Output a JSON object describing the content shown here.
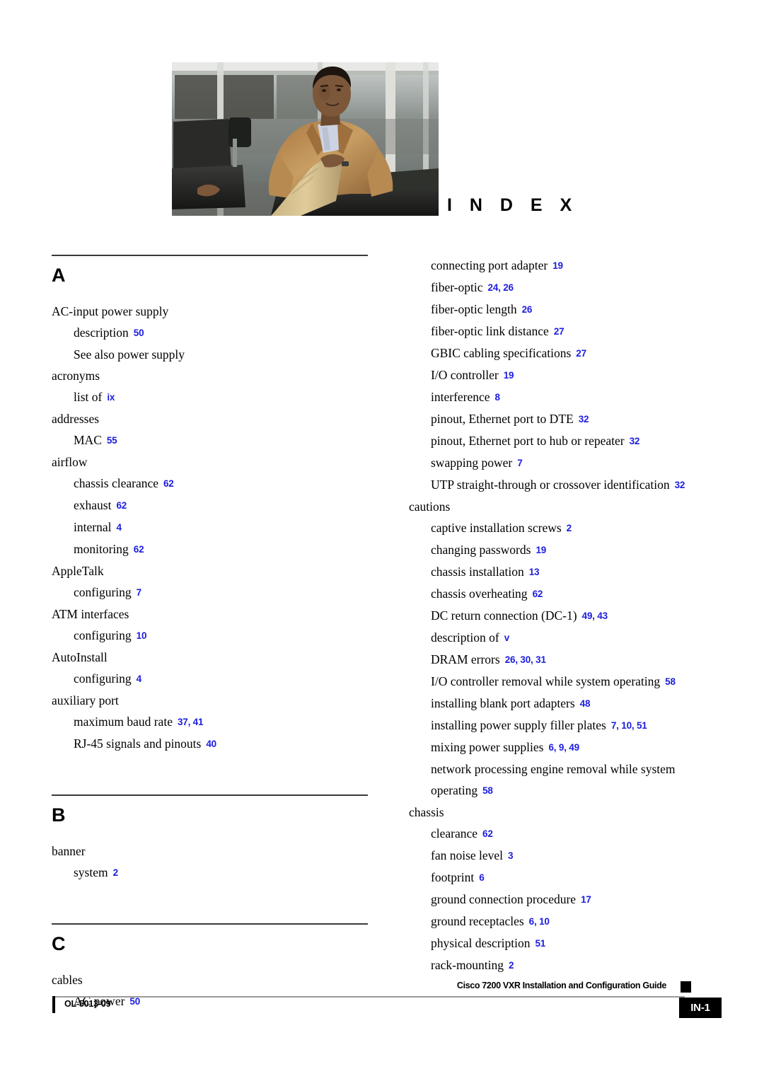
{
  "page": {
    "index_title": "I N D E X",
    "accent_page_number_color": "#1c1ce0",
    "rule_color": "#3a3a3a"
  },
  "photo": {
    "name": "cover-photo-seated-man",
    "description": "Seated man in tan jacket and khaki trousers on a dark leather sofa in front of large industrial windows"
  },
  "columns": {
    "left": {
      "sections": [
        {
          "letter": "A",
          "entries": [
            {
              "level": 0,
              "text": "AC-input power supply",
              "pages": ""
            },
            {
              "level": 1,
              "text": "description",
              "pages": "50"
            },
            {
              "level": 1,
              "text": "See also power supply",
              "pages": ""
            },
            {
              "level": 0,
              "text": "acronyms",
              "pages": ""
            },
            {
              "level": 1,
              "text": "list of",
              "pages": "ix"
            },
            {
              "level": 0,
              "text": "addresses",
              "pages": ""
            },
            {
              "level": 1,
              "text": "MAC",
              "pages": "55"
            },
            {
              "level": 0,
              "text": "airflow",
              "pages": ""
            },
            {
              "level": 1,
              "text": "chassis clearance",
              "pages": "62"
            },
            {
              "level": 1,
              "text": "exhaust",
              "pages": "62"
            },
            {
              "level": 1,
              "text": "internal",
              "pages": "4"
            },
            {
              "level": 1,
              "text": "monitoring",
              "pages": "62"
            },
            {
              "level": 0,
              "text": "AppleTalk",
              "pages": ""
            },
            {
              "level": 1,
              "text": "configuring",
              "pages": "7"
            },
            {
              "level": 0,
              "text": "ATM interfaces",
              "pages": ""
            },
            {
              "level": 1,
              "text": "configuring",
              "pages": "10"
            },
            {
              "level": 0,
              "text": "AutoInstall",
              "pages": ""
            },
            {
              "level": 1,
              "text": "configuring",
              "pages": "4"
            },
            {
              "level": 0,
              "text": "auxiliary port",
              "pages": ""
            },
            {
              "level": 1,
              "text": "maximum baud rate",
              "pages": "37, 41"
            },
            {
              "level": 1,
              "text": "RJ-45 signals and pinouts",
              "pages": "40"
            }
          ]
        },
        {
          "letter": "B",
          "entries": [
            {
              "level": 0,
              "text": "banner",
              "pages": ""
            },
            {
              "level": 1,
              "text": "system",
              "pages": "2"
            }
          ]
        },
        {
          "letter": "C",
          "entries": [
            {
              "level": 0,
              "text": "cables",
              "pages": ""
            },
            {
              "level": 1,
              "text": "AC power",
              "pages": "50"
            }
          ]
        }
      ]
    },
    "right": {
      "sections": [
        {
          "letter": "",
          "entries": [
            {
              "level": 1,
              "text": "connecting port adapter",
              "pages": "19"
            },
            {
              "level": 1,
              "text": "fiber-optic",
              "pages": "24, 26"
            },
            {
              "level": 1,
              "text": "fiber-optic length",
              "pages": "26"
            },
            {
              "level": 1,
              "text": "fiber-optic link distance",
              "pages": "27"
            },
            {
              "level": 1,
              "text": "GBIC cabling specifications",
              "pages": "27"
            },
            {
              "level": 1,
              "text": "I/O controller",
              "pages": "19"
            },
            {
              "level": 1,
              "text": "interference",
              "pages": "8"
            },
            {
              "level": 1,
              "text": "pinout, Ethernet port to DTE",
              "pages": "32"
            },
            {
              "level": 1,
              "text": "pinout, Ethernet port to hub or repeater",
              "pages": "32"
            },
            {
              "level": 1,
              "text": "swapping power",
              "pages": "7"
            },
            {
              "level": 1,
              "text": "UTP straight-through or crossover identification",
              "pages": "32"
            },
            {
              "level": 0,
              "text": "cautions",
              "pages": ""
            },
            {
              "level": 1,
              "text": "captive installation screws",
              "pages": "2"
            },
            {
              "level": 1,
              "text": "changing passwords",
              "pages": "19"
            },
            {
              "level": 1,
              "text": "chassis installation",
              "pages": "13"
            },
            {
              "level": 1,
              "text": "chassis overheating",
              "pages": "62"
            },
            {
              "level": 1,
              "text": "DC return connection (DC-1)",
              "pages": "49, 43"
            },
            {
              "level": 1,
              "text": "description of",
              "pages": "v"
            },
            {
              "level": 1,
              "text": "DRAM errors",
              "pages": "26, 30, 31"
            },
            {
              "level": 1,
              "text": "I/O controller removal while system operating",
              "pages": "58"
            },
            {
              "level": 1,
              "text": "installing blank port adapters",
              "pages": "48"
            },
            {
              "level": 1,
              "text": "installing power supply filler plates",
              "pages": "7, 10, 51"
            },
            {
              "level": 1,
              "text": "mixing power supplies",
              "pages": "6, 9, 49"
            },
            {
              "level": 1,
              "text": "network processing engine removal while system operating",
              "pages": "58"
            },
            {
              "level": 0,
              "text": "chassis",
              "pages": ""
            },
            {
              "level": 1,
              "text": "clearance",
              "pages": "62"
            },
            {
              "level": 1,
              "text": "fan noise level",
              "pages": "3"
            },
            {
              "level": 1,
              "text": "footprint",
              "pages": "6"
            },
            {
              "level": 1,
              "text": "ground connection procedure",
              "pages": "17"
            },
            {
              "level": 1,
              "text": "ground receptacles",
              "pages": "6, 10"
            },
            {
              "level": 1,
              "text": "physical description",
              "pages": "51"
            },
            {
              "level": 1,
              "text": "rack-mounting",
              "pages": "2"
            }
          ]
        }
      ]
    }
  },
  "footer": {
    "document_title": "Cisco 7200 VXR Installation and Configuration Guide",
    "document_id": "OL-5013-09",
    "page_number": "IN-1"
  }
}
